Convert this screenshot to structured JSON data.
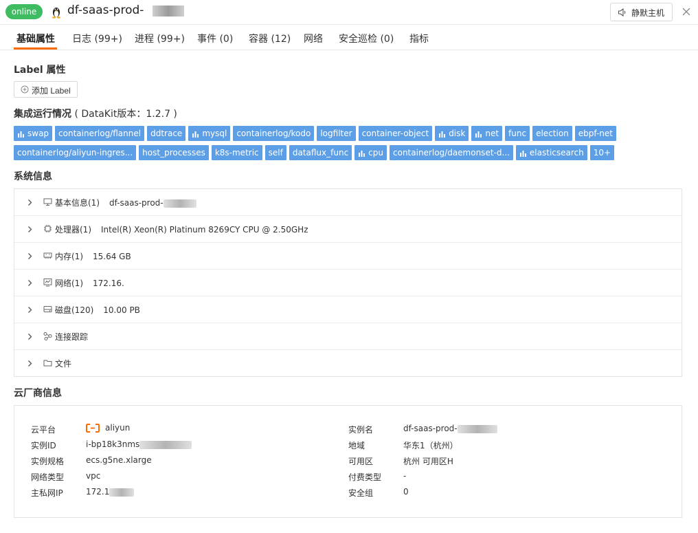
{
  "header": {
    "status_badge": "online",
    "host_title": "df-saas-prod-",
    "mute_button": "静默主机"
  },
  "tabs": [
    {
      "label": "基础属性",
      "active": true
    },
    {
      "label": "日志 (99+)"
    },
    {
      "label": "进程 (99+)"
    },
    {
      "label": "事件 (0)"
    },
    {
      "label": "容器 (12)"
    },
    {
      "label": "网络"
    },
    {
      "label": "安全巡检 (0)"
    },
    {
      "label": "指标"
    }
  ],
  "label_section": {
    "title": "Label 属性",
    "add_button": "添加 Label"
  },
  "integration": {
    "title": "集成运行情况",
    "version": "( DataKit版本：1.2.7 )",
    "tags_row1": [
      {
        "label": "swap",
        "icon": "bar-chart-icon"
      },
      {
        "label": "containerlog/flannel"
      },
      {
        "label": "ddtrace"
      },
      {
        "label": "mysql",
        "icon": "bar-chart-icon"
      },
      {
        "label": "containerlog/kodo"
      },
      {
        "label": "logfilter"
      },
      {
        "label": "container-object"
      },
      {
        "label": "disk",
        "icon": "bar-chart-icon"
      },
      {
        "label": "net",
        "icon": "bar-chart-icon"
      },
      {
        "label": "func"
      },
      {
        "label": "election"
      },
      {
        "label": "ebpf-net"
      }
    ],
    "tags_row2": [
      {
        "label": "containerlog/aliyun-ingres..."
      },
      {
        "label": "host_processes"
      },
      {
        "label": "k8s-metric"
      },
      {
        "label": "self"
      },
      {
        "label": "dataflux_func"
      },
      {
        "label": "cpu",
        "icon": "bar-chart-icon"
      },
      {
        "label": "containerlog/daemonset-d..."
      },
      {
        "label": "elasticsearch",
        "icon": "bar-chart-icon"
      },
      {
        "label": "10+"
      }
    ]
  },
  "system_info": {
    "title": "系统信息",
    "rows": [
      {
        "label": "基本信息(1)",
        "value": "df-saas-prod-",
        "icon": "monitor-icon"
      },
      {
        "label": "处理器(1)",
        "value": "Intel(R) Xeon(R) Platinum 8269CY CPU @ 2.50GHz",
        "icon": "cpu-icon"
      },
      {
        "label": "内存(1)",
        "value": "15.64 GB",
        "icon": "memory-icon"
      },
      {
        "label": "网络(1)",
        "value": "172.16.",
        "icon": "network-icon"
      },
      {
        "label": "磁盘(120)",
        "value": "10.00 PB",
        "icon": "disk-icon"
      },
      {
        "label": "连接跟踪",
        "value": "",
        "icon": "connection-icon"
      },
      {
        "label": "文件",
        "value": "",
        "icon": "folder-icon"
      }
    ]
  },
  "cloud": {
    "title": "云厂商信息",
    "left": [
      {
        "k": "云平台",
        "v": "aliyun"
      },
      {
        "k": "实例ID",
        "v": "i-bp18k3nms"
      },
      {
        "k": "实例规格",
        "v": "ecs.g5ne.xlarge"
      },
      {
        "k": "网络类型",
        "v": "vpc"
      },
      {
        "k": "主私网IP",
        "v": "172.1"
      }
    ],
    "right": [
      {
        "k": "实例名",
        "v": "df-saas-prod-"
      },
      {
        "k": "地域",
        "v": "华东1（杭州）"
      },
      {
        "k": "可用区",
        "v": "杭州 可用区H"
      },
      {
        "k": "付费类型",
        "v": "-"
      },
      {
        "k": "安全组",
        "v": "0"
      }
    ]
  }
}
